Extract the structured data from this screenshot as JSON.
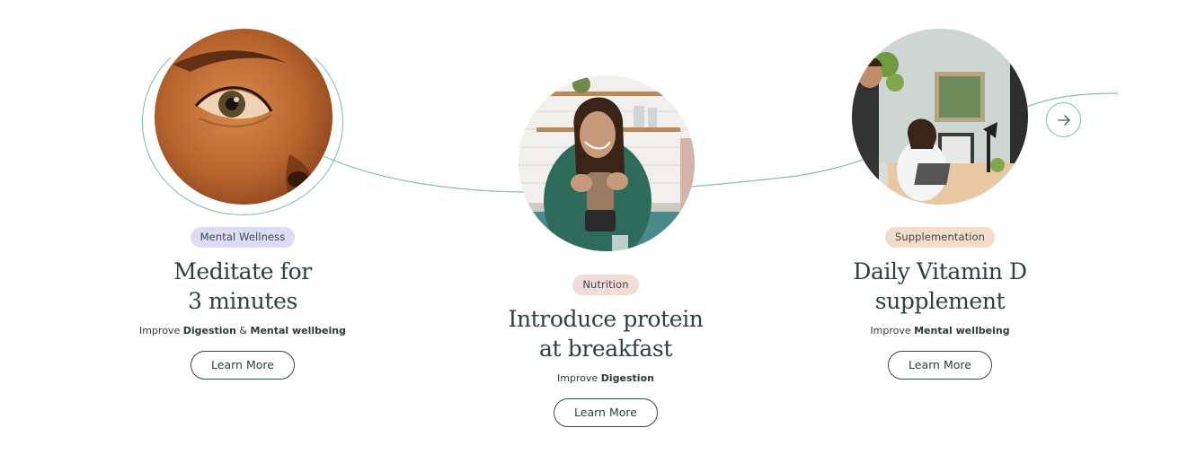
{
  "cards": [
    {
      "category": "Mental Wellness",
      "category_color": "#dcdcf7",
      "title_line1": "Meditate for",
      "title_line2": "3 minutes",
      "improve_prefix": "Improve",
      "benefit1": "Digestion",
      "joiner": "&",
      "benefit2": "Mental wellbeing",
      "button": "Learn More",
      "image": "close-up-eye-photo"
    },
    {
      "category": "Nutrition",
      "category_color": "#f4dcd6",
      "title_line1": "Introduce protein",
      "title_line2": "at breakfast",
      "improve_prefix": "Improve",
      "benefit1": "Digestion",
      "button": "Learn More",
      "image": "woman-blender-kitchen-photo"
    },
    {
      "category": "Supplementation",
      "category_color": "#f3dccb",
      "title_line1": "Daily Vitamin D",
      "title_line2": "supplement",
      "improve_prefix": "Improve",
      "benefit1": "Mental wellbeing",
      "button": "Learn More",
      "image": "office-consultation-photo"
    }
  ],
  "carousel": {
    "next_icon": "arrow-right-icon",
    "accent_color": "#7fb8ad"
  }
}
